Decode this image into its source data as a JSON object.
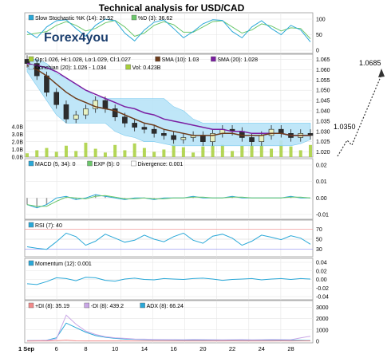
{
  "title": "Technical analysis for USD/CAD",
  "brand": "Forex4you",
  "colors": {
    "panel_bg": "#ffffff",
    "grid": "#e6e6e6",
    "cloud": "#b9e4f8",
    "cloud_edge": "#6ec6ee"
  },
  "panels": {
    "stoch": {
      "legend": [
        "Slow Stochastic %K (14): 26.52",
        "%D (3): 36.62"
      ],
      "ticks": [
        "100",
        "50",
        "0"
      ]
    },
    "price": {
      "legend_row1": [
        "Op:1.026, Hi:1.028, Lo:1.029, Cl:1.027",
        "SMA (10): 1.03",
        "SMA (20): 1.028"
      ],
      "legend_row2": [
        "Donchian (20): 1.026 - 1.034",
        "Vol: 0.423B"
      ],
      "ticks": [
        "1.065",
        "1.060",
        "1.055",
        "1.050",
        "1.045",
        "1.040",
        "1.035",
        "1.030",
        "1.025",
        "1.020"
      ],
      "vol_ticks": [
        "4.0B",
        "3.0B",
        "2.0B",
        "1.0B",
        "0.0B"
      ]
    },
    "macd": {
      "legend": [
        "MACD (5, 34): 0",
        "EXP (5): 0",
        "Divergence: 0.001"
      ],
      "ticks": [
        "0.02",
        "0.01",
        "0.00",
        "-0.01"
      ]
    },
    "rsi": {
      "legend": [
        "RSI (7): 40"
      ],
      "ticks": [
        "70",
        "50",
        "30"
      ]
    },
    "momentum": {
      "legend": [
        "Momentum (12): 0.001"
      ],
      "ticks": [
        "0.04",
        "0.02",
        "0.00",
        "-0.02",
        "-0.04"
      ]
    },
    "dmi": {
      "legend": [
        "+DI (8): 35.19",
        "-DI (8): 439.2",
        "ADX (8): 66.24"
      ],
      "ticks": [
        "3000",
        "2000",
        "1000",
        "0"
      ]
    }
  },
  "x_dates": [
    "1 Sep",
    "6",
    "8",
    "10",
    "14",
    "16",
    "20",
    "22",
    "24",
    "28"
  ],
  "projection": {
    "labels": [
      "1.0685",
      "1.0350"
    ]
  },
  "chart_data": {
    "type": "candlestick",
    "title": "Technical analysis for USD/CAD",
    "categories": [
      "1 Sep",
      "6",
      "8",
      "10",
      "14",
      "16",
      "20",
      "22",
      "24",
      "28"
    ],
    "close": [
      1.063,
      1.057,
      1.049,
      1.043,
      1.036,
      1.038,
      1.041,
      1.045,
      1.041,
      1.037,
      1.034,
      1.032,
      1.031,
      1.029,
      1.028,
      1.026,
      1.027,
      1.028,
      1.025,
      1.029,
      1.031,
      1.03,
      1.027,
      1.025,
      1.028,
      1.031,
      1.029,
      1.027,
      1.029,
      1.028
    ],
    "sma10": [
      1.062,
      1.06,
      1.057,
      1.053,
      1.049,
      1.046,
      1.044,
      1.042,
      1.041,
      1.04,
      1.038,
      1.036,
      1.034,
      1.033,
      1.031,
      1.03,
      1.029,
      1.028,
      1.028,
      1.028,
      1.029,
      1.029,
      1.028,
      1.028,
      1.028,
      1.029,
      1.029,
      1.028,
      1.028,
      1.028
    ],
    "sma20": [
      1.063,
      1.062,
      1.061,
      1.059,
      1.056,
      1.053,
      1.05,
      1.048,
      1.046,
      1.044,
      1.042,
      1.041,
      1.039,
      1.038,
      1.036,
      1.035,
      1.034,
      1.033,
      1.032,
      1.031,
      1.031,
      1.03,
      1.03,
      1.029,
      1.029,
      1.029,
      1.029,
      1.028,
      1.028,
      1.028
    ],
    "donchian_upper": [
      1.065,
      1.065,
      1.063,
      1.058,
      1.056,
      1.053,
      1.05,
      1.047,
      1.046,
      1.046,
      1.046,
      1.046,
      1.046,
      1.046,
      1.046,
      1.042,
      1.04,
      1.036,
      1.034,
      1.034,
      1.034,
      1.034,
      1.034,
      1.034,
      1.034,
      1.034,
      1.034,
      1.034,
      1.034,
      1.034
    ],
    "donchian_lower": [
      1.059,
      1.052,
      1.045,
      1.038,
      1.034,
      1.034,
      1.034,
      1.034,
      1.034,
      1.03,
      1.028,
      1.027,
      1.025,
      1.025,
      1.024,
      1.023,
      1.023,
      1.023,
      1.023,
      1.023,
      1.023,
      1.023,
      1.023,
      1.023,
      1.023,
      1.023,
      1.023,
      1.023,
      1.024,
      1.026
    ],
    "volume": [
      0.5,
      0.9,
      1.2,
      0.7,
      1.5,
      0.8,
      1.9,
      1.1,
      0.6,
      1.6,
      0.9,
      1.8,
      1.2,
      0.7,
      1.0,
      2.1,
      1.3,
      0.6,
      1.4,
      2.3,
      1.7,
      0.8,
      1.5,
      2.6,
      1.9,
      1.1,
      2.2,
      1.4,
      0.9,
      1.6
    ],
    "stoch_k": [
      60,
      40,
      75,
      95,
      98,
      70,
      45,
      80,
      100,
      95,
      55,
      30,
      65,
      90,
      98,
      70,
      40,
      60,
      85,
      98,
      96,
      60,
      40,
      75,
      95,
      70,
      50,
      80,
      65,
      27
    ],
    "stoch_d": [
      50,
      55,
      60,
      80,
      92,
      80,
      62,
      70,
      88,
      96,
      75,
      45,
      55,
      80,
      92,
      82,
      58,
      58,
      75,
      92,
      95,
      75,
      55,
      65,
      85,
      78,
      62,
      72,
      70,
      37
    ],
    "rsi": [
      35,
      32,
      30,
      45,
      62,
      55,
      38,
      46,
      60,
      52,
      44,
      48,
      58,
      50,
      45,
      55,
      62,
      48,
      42,
      56,
      60,
      52,
      38,
      46,
      58,
      54,
      49,
      57,
      52,
      40
    ],
    "momentum": [
      -0.01,
      -0.012,
      -0.005,
      0.004,
      0.002,
      -0.003,
      0.005,
      0.004,
      -0.002,
      -0.004,
      0.001,
      0.003,
      0.0,
      -0.001,
      0.002,
      0.001,
      0.0,
      0.002,
      0.003,
      0.001,
      -0.002,
      0.0,
      0.001,
      0.002,
      -0.001,
      0.001,
      0.002,
      0.0,
      0.002,
      0.001
    ],
    "macd": [
      -0.004,
      -0.006,
      -0.004,
      0.0,
      0.001,
      -0.001,
      0.0,
      0.002,
      0.001,
      0.0,
      -0.001,
      0.0,
      0.0,
      -0.001,
      0.0,
      0.0,
      0.0,
      0.001,
      0.0,
      0.0,
      0.0,
      0.001,
      0.0,
      0.0,
      0.0,
      0.0,
      0.0,
      0.001,
      0.0,
      0.0
    ],
    "plus_di": [
      20,
      25,
      30,
      40,
      100,
      35,
      28,
      30,
      25,
      30,
      28,
      30,
      26,
      28,
      30,
      27,
      25,
      30,
      28,
      26,
      30,
      32,
      29,
      27,
      30,
      28,
      33,
      30,
      32,
      35
    ],
    "minus_di": [
      40,
      60,
      80,
      200,
      2300,
      1500,
      900,
      600,
      400,
      300,
      250,
      200,
      180,
      160,
      150,
      140,
      130,
      150,
      140,
      130,
      120,
      130,
      140,
      120,
      130,
      150,
      140,
      130,
      300,
      439
    ],
    "adx": [
      50,
      60,
      90,
      300,
      1600,
      1200,
      800,
      500,
      350,
      250,
      200,
      170,
      150,
      130,
      120,
      110,
      100,
      110,
      100,
      95,
      90,
      95,
      100,
      90,
      95,
      100,
      95,
      90,
      80,
      66
    ],
    "ylim_price": [
      1.0175,
      1.0675
    ],
    "projection_levels": [
      1.0685,
      1.035
    ]
  }
}
